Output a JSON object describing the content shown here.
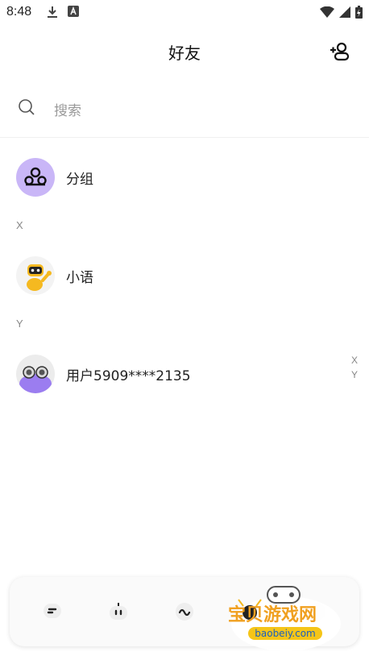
{
  "status_bar": {
    "time": "8:48"
  },
  "header": {
    "title": "好友"
  },
  "search": {
    "placeholder": "搜索"
  },
  "group_row": {
    "label": "分组"
  },
  "sections": [
    {
      "letter": "X",
      "items": [
        {
          "name": "小语"
        }
      ]
    },
    {
      "letter": "Y",
      "items": [
        {
          "name": "用户5909****2135"
        }
      ]
    }
  ],
  "alpha_index": [
    "X",
    "Y"
  ],
  "bottom_nav": {
    "items": [
      {
        "icon": "chat-icon"
      },
      {
        "icon": "robot-icon"
      },
      {
        "icon": "wave-icon"
      },
      {
        "icon": "friends-icon"
      },
      {
        "icon": "profile-icon"
      }
    ]
  },
  "watermark": {
    "text": "宝贝游戏网",
    "url": "baobeiy.com"
  },
  "colors": {
    "group_avatar_bg": "#c9b6f7",
    "accent_purple": "#8b5cf6"
  }
}
